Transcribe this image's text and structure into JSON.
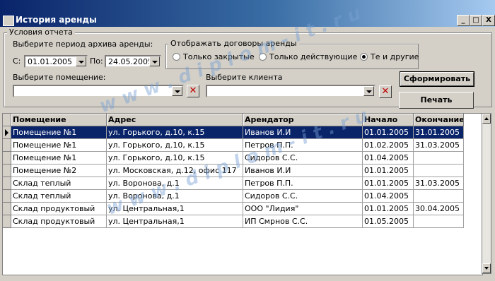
{
  "window": {
    "title": "История аренды",
    "min": "_",
    "max": "□",
    "close": "X"
  },
  "group": {
    "title": "Условия отчета"
  },
  "period": {
    "label": "Выберите период архива аренды:",
    "from_label": "С:",
    "from_value": "01.01.2005",
    "to_label": "По:",
    "to_value": "24.05.2005"
  },
  "contracts": {
    "title": "Отображать договоры аренды",
    "opt_closed": "Только закрытые",
    "opt_active": "Только действующие",
    "opt_both": "Те и другие",
    "selected": "both"
  },
  "premises": {
    "label": "Выберите помещение:",
    "value": ""
  },
  "client": {
    "label": "Выберите клиента",
    "value": ""
  },
  "buttons": {
    "generate": "Сформировать",
    "print": "Печать"
  },
  "table": {
    "headers": [
      "Помещение",
      "Адрес",
      "Арендатор",
      "Начало",
      "Окончание"
    ],
    "rows": [
      [
        "Помещение №1",
        "ул. Горького, д.10, к.15",
        "Иванов И.И",
        "01.01.2005",
        "31.01.2005"
      ],
      [
        "Помещение №1",
        "ул. Горького, д.10, к.15",
        "Петров П.П.",
        "01.02.2005",
        "31.03.2005"
      ],
      [
        "Помещение №1",
        "ул. Горького, д.10, к.15",
        "Сидоров С.С.",
        "01.04.2005",
        ""
      ],
      [
        "Помещение №2",
        "ул. Московская, д.12, офис 117",
        "Иванов И.И",
        "01.01.2005",
        ""
      ],
      [
        "Склад теплый",
        "ул. Воронова, д.1",
        "Петров П.П.",
        "01.01.2005",
        "31.03.2005"
      ],
      [
        "Склад теплый",
        "ул. Воронова, д.1",
        "Сидоров С.С.",
        "01.04.2005",
        ""
      ],
      [
        "Склад продуктовый",
        "ул. Центральная,1",
        "ООО \"Лидия\"",
        "01.01.2005",
        "30.04.2005"
      ],
      [
        "Склад продуктовый",
        "ул. Центральная,1",
        "ИП Смрнов С.С.",
        "01.05.2005",
        ""
      ]
    ]
  },
  "watermark": "w w w . d i p l o m - i t . r u"
}
